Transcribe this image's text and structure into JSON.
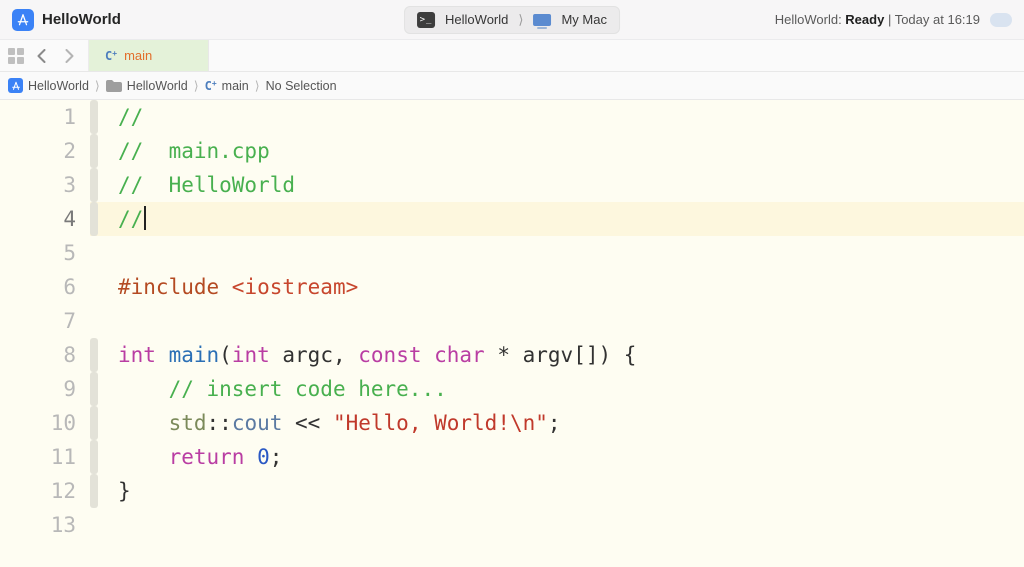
{
  "toolbar": {
    "project_name": "HelloWorld",
    "scheme_name": "HelloWorld",
    "destination_name": "My Mac",
    "status_prefix": "HelloWorld: ",
    "status_state": "Ready",
    "status_sep": " | ",
    "status_time": "Today at 16:19"
  },
  "tabbar": {
    "active_tab_label": "main"
  },
  "jumpbar": {
    "project": "HelloWorld",
    "folder": "HelloWorld",
    "icon_text_C": "C",
    "icon_text_plus": "+",
    "file": "main",
    "selection": "No Selection"
  },
  "code": {
    "lines": [
      {
        "n": "1",
        "ribbon": true,
        "hl": false,
        "tokens": [
          [
            "c-comment",
            "//"
          ]
        ]
      },
      {
        "n": "2",
        "ribbon": true,
        "hl": false,
        "tokens": [
          [
            "c-comment",
            "//  main.cpp"
          ]
        ]
      },
      {
        "n": "3",
        "ribbon": true,
        "hl": false,
        "tokens": [
          [
            "c-comment",
            "//  HelloWorld"
          ]
        ]
      },
      {
        "n": "4",
        "ribbon": true,
        "hl": true,
        "cursor": true,
        "tokens": [
          [
            "c-comment",
            "//"
          ]
        ]
      },
      {
        "n": "5",
        "ribbon": false,
        "hl": false,
        "tokens": []
      },
      {
        "n": "6",
        "ribbon": false,
        "hl": false,
        "tokens": [
          [
            "c-pp",
            "#include "
          ],
          [
            "c-inc",
            "<iostream>"
          ]
        ]
      },
      {
        "n": "7",
        "ribbon": false,
        "hl": false,
        "tokens": []
      },
      {
        "n": "8",
        "ribbon": true,
        "hl": false,
        "tokens": [
          [
            "c-type",
            "int "
          ],
          [
            "c-fn",
            "main"
          ],
          [
            "c-plain",
            "("
          ],
          [
            "c-type",
            "int"
          ],
          [
            "c-plain",
            " argc, "
          ],
          [
            "c-type",
            "const char"
          ],
          [
            "c-plain",
            " * argv[]) {"
          ]
        ]
      },
      {
        "n": "9",
        "ribbon": true,
        "hl": false,
        "tokens": [
          [
            "c-plain",
            "    "
          ],
          [
            "c-comment",
            "// insert code here..."
          ]
        ]
      },
      {
        "n": "10",
        "ribbon": true,
        "hl": false,
        "tokens": [
          [
            "c-plain",
            "    "
          ],
          [
            "c-ns",
            "std"
          ],
          [
            "c-plain",
            "::"
          ],
          [
            "c-member",
            "cout"
          ],
          [
            "c-plain",
            " << "
          ],
          [
            "c-str",
            "\"Hello, World!\\n\""
          ],
          [
            "c-plain",
            ";"
          ]
        ]
      },
      {
        "n": "11",
        "ribbon": true,
        "hl": false,
        "tokens": [
          [
            "c-plain",
            "    "
          ],
          [
            "c-kw",
            "return"
          ],
          [
            "c-plain",
            " "
          ],
          [
            "c-num",
            "0"
          ],
          [
            "c-plain",
            ";"
          ]
        ]
      },
      {
        "n": "12",
        "ribbon": true,
        "hl": false,
        "tokens": [
          [
            "c-plain",
            "}"
          ]
        ]
      },
      {
        "n": "13",
        "ribbon": false,
        "hl": false,
        "tokens": []
      }
    ]
  }
}
